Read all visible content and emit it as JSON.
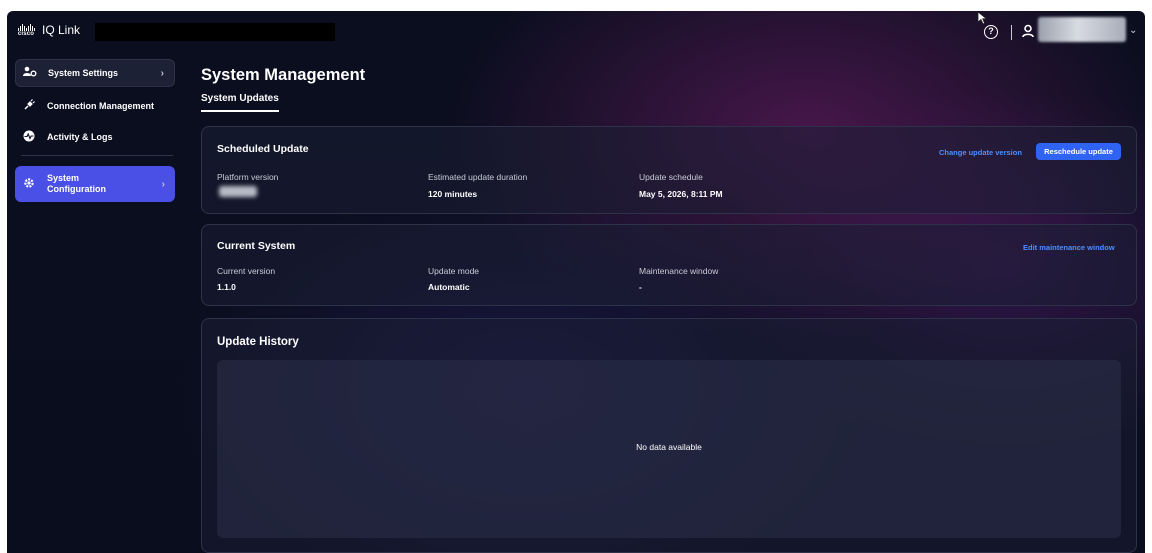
{
  "app": {
    "brand_text": "cisco",
    "title": "IQ Link"
  },
  "header": {
    "help_icon": "help-circle-icon",
    "user_icon": "user-icon",
    "help_glyph": "?"
  },
  "sidebar": {
    "items": [
      {
        "label": "System Settings",
        "icon": "users-gear-icon",
        "has_chevron": true
      },
      {
        "label": "Connection Management",
        "icon": "plug-icon"
      },
      {
        "label": "Activity & Logs",
        "icon": "activity-icon"
      },
      {
        "label_line1": "System",
        "label_line2": "Configuration",
        "icon": "gear-icon",
        "active": true
      }
    ],
    "chevron": "›"
  },
  "main": {
    "title": "System Management",
    "tabs": [
      {
        "label": "System Updates",
        "active": true
      }
    ]
  },
  "scheduled_update": {
    "title": "Scheduled Update",
    "change_link": "Change update version",
    "reschedule_button": "Reschedule update",
    "platform_label": "Platform version",
    "duration_label": "Estimated update duration",
    "duration_value": "120 minutes",
    "schedule_label": "Update schedule",
    "schedule_value": "May 5, 2026, 8:11 PM"
  },
  "current_system": {
    "title": "Current System",
    "edit_link": "Edit maintenance window",
    "version_label": "Current version",
    "version_value": "1.1.0",
    "mode_label": "Update mode",
    "mode_value": "Automatic",
    "window_label": "Maintenance window",
    "window_value": "-"
  },
  "update_history": {
    "title": "Update History",
    "empty_text": "No data available"
  },
  "colors": {
    "accent": "#4a4fe6",
    "primary_button": "#2e63f4",
    "link": "#4d8fff",
    "background": "#0b0e1f"
  }
}
